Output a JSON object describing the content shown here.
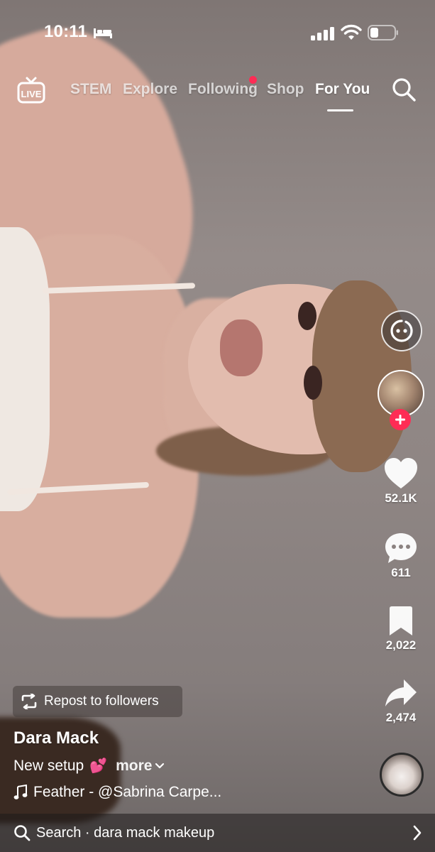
{
  "status_bar": {
    "time": "10:11",
    "icons": [
      "bed-icon",
      "cellular-signal-icon",
      "wifi-icon",
      "battery-icon"
    ]
  },
  "top_nav": {
    "live_label": "LIVE",
    "tabs": [
      {
        "label": "STEM",
        "active": false
      },
      {
        "label": "Explore",
        "active": false
      },
      {
        "label": "Following",
        "active": false,
        "has_notification_dot": true
      },
      {
        "label": "Shop",
        "active": false
      },
      {
        "label": "For You",
        "active": true
      }
    ],
    "search_icon": "search-icon"
  },
  "right_rail": {
    "effect_icon": "face-effect-icon",
    "follow_icon": "plus-icon",
    "like_count": "52.1K",
    "comment_count": "611",
    "save_count": "2,022",
    "share_count": "2,474"
  },
  "post": {
    "repost_label": "Repost to followers",
    "username": "Dara Mack",
    "caption": "New setup",
    "caption_emoji": "💕",
    "more_label": "more",
    "sound": "Feather - @Sabrina Carpe..."
  },
  "search_bar": {
    "label": "Search · dara mack makeup"
  },
  "colors": {
    "accent_red": "#fe2c55",
    "text": "#ffffff"
  }
}
